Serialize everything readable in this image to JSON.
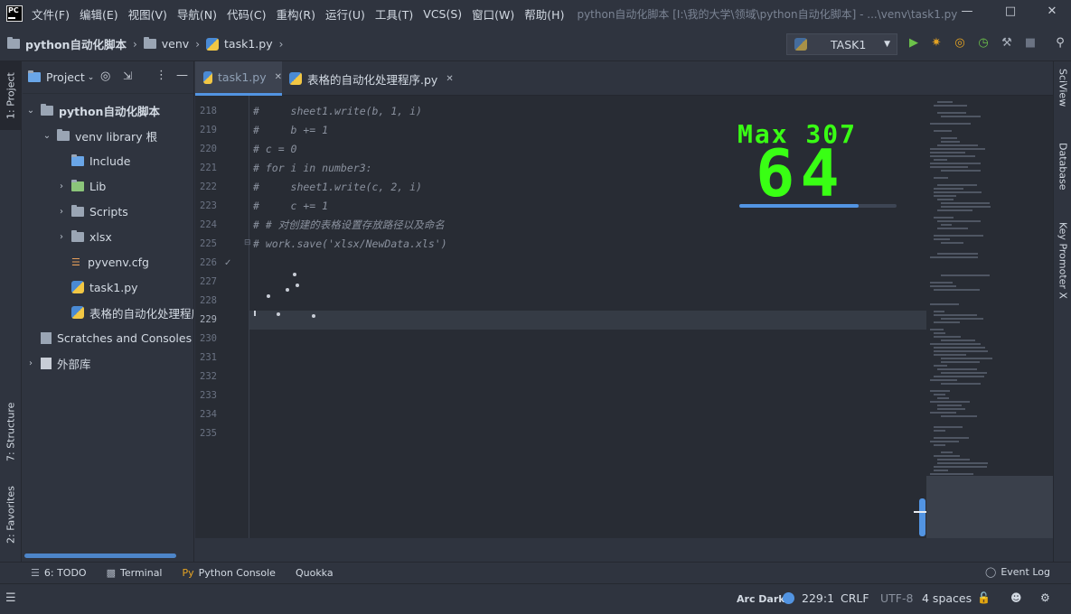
{
  "menu": {
    "items": [
      "文件(F)",
      "编辑(E)",
      "视图(V)",
      "导航(N)",
      "代码(C)",
      "重构(R)",
      "运行(U)",
      "工具(T)",
      "VCS(S)",
      "窗口(W)",
      "帮助(H)"
    ],
    "window_title": "python自动化脚本 [I:\\我的大学\\领域\\python自动化脚本] - ...\\venv\\task1.py",
    "app_logo": "PC"
  },
  "breadcrumb": [
    "python自动化脚本",
    "venv",
    "task1.py"
  ],
  "run_config": {
    "label": "TASK1"
  },
  "left_tools": {
    "project": "1: Project",
    "structure": "7: Structure",
    "favorites": "2: Favorites"
  },
  "right_tools": {
    "sciview": "SciView",
    "database": "Database",
    "key_promoter": "Key Promoter X"
  },
  "project_panel": {
    "title": "Project",
    "tree": [
      {
        "label": "python自动化脚本",
        "type": "folder",
        "bold": true
      },
      {
        "label": "venv library 根",
        "type": "folder"
      },
      {
        "label": "Include",
        "type": "folder"
      },
      {
        "label": "Lib",
        "type": "folder"
      },
      {
        "label": "Scripts",
        "type": "folder"
      },
      {
        "label": "xlsx",
        "type": "folder"
      },
      {
        "label": "pyvenv.cfg",
        "type": "cfg"
      },
      {
        "label": "task1.py",
        "type": "py"
      },
      {
        "label": "表格的自动化处理程序",
        "type": "py"
      },
      {
        "label": "Scratches and Consoles",
        "type": "scratch"
      },
      {
        "label": "外部库",
        "type": "lib"
      }
    ]
  },
  "editor_tabs": [
    {
      "label": "task1.py",
      "active": true
    },
    {
      "label": "表格的自动化处理程序.py",
      "active": false
    }
  ],
  "editor": {
    "line_numbers": [
      "218",
      "219",
      "220",
      "221",
      "222",
      "223",
      "224",
      "225",
      "226",
      "227",
      "228",
      "229",
      "230",
      "231",
      "232",
      "233",
      "234",
      "235"
    ],
    "code_lines": [
      "#     sheet1.write(b, 1, i)",
      "#     b += 1",
      "# c = 0",
      "# for i in number3:",
      "#     sheet1.write(c, 2, i)",
      "#     c += 1",
      "# # 对创建的表格设置存放路径以及命名",
      "# work.save('xlsx/NewData.xls')"
    ],
    "current_line": "229"
  },
  "combo": {
    "max_label": "Max 307",
    "count": "64",
    "progress": 0.76
  },
  "bottom_tabs": [
    "6: TODO",
    "Terminal",
    "Python Console",
    "Quokka",
    "Event Log"
  ],
  "status": {
    "theme": "Arc Dark",
    "position": "229:1",
    "line_ending": "CRLF",
    "encoding": "UTF-8",
    "indent": "4 spaces"
  },
  "colors": {
    "accent": "#5294e2",
    "combo_green": "#39ff14",
    "background": "#2f343f",
    "editor_bg": "#282c34"
  }
}
